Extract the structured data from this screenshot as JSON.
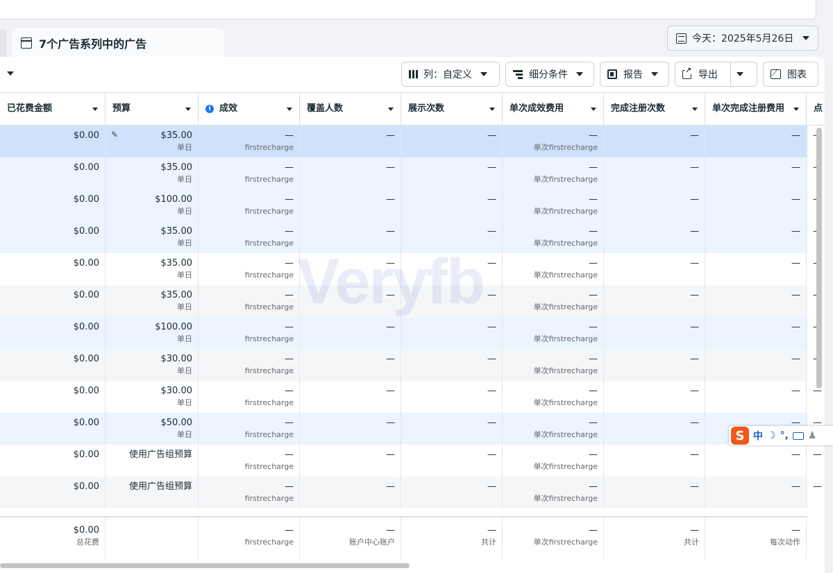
{
  "tab_title": "7个广告系列中的广告",
  "date_range_label": "今天：2025年5月26日",
  "toolbar": {
    "columns_label": "列：自定义",
    "breakdown_label": "细分条件",
    "reports_label": "报告",
    "export_label": "导出",
    "charts_label": "图表"
  },
  "columns": [
    "已花费金额",
    "预算",
    "成效",
    "覆盖人数",
    "展示次数",
    "单次成效费用",
    "完成注册次数",
    "单次完成注册费用",
    "点"
  ],
  "rows": [
    {
      "spend": "$0.00",
      "budget": "$35.00",
      "budget_type": "单日",
      "results": "—",
      "results_sub": "firstrecharge",
      "reach": "—",
      "impressions": "—",
      "cpr": "—",
      "cpr_sub": "单次firstrecharge",
      "regs": "—",
      "cost_reg": "—",
      "last": "—"
    },
    {
      "spend": "$0.00",
      "budget": "$35.00",
      "budget_type": "单日",
      "results": "—",
      "results_sub": "firstrecharge",
      "reach": "—",
      "impressions": "—",
      "cpr": "—",
      "cpr_sub": "单次firstrecharge",
      "regs": "—",
      "cost_reg": "—",
      "last": "—"
    },
    {
      "spend": "$0.00",
      "budget": "$100.00",
      "budget_type": "单日",
      "results": "—",
      "results_sub": "firstrecharge",
      "reach": "—",
      "impressions": "—",
      "cpr": "—",
      "cpr_sub": "单次firstrecharge",
      "regs": "—",
      "cost_reg": "—",
      "last": "—"
    },
    {
      "spend": "$0.00",
      "budget": "$35.00",
      "budget_type": "单日",
      "results": "—",
      "results_sub": "firstrecharge",
      "reach": "—",
      "impressions": "—",
      "cpr": "—",
      "cpr_sub": "单次firstrecharge",
      "regs": "—",
      "cost_reg": "—",
      "last": "—"
    },
    {
      "spend": "$0.00",
      "budget": "$35.00",
      "budget_type": "单日",
      "results": "—",
      "results_sub": "firstrecharge",
      "reach": "—",
      "impressions": "—",
      "cpr": "—",
      "cpr_sub": "单次firstrecharge",
      "regs": "—",
      "cost_reg": "—",
      "last": "—"
    },
    {
      "spend": "$0.00",
      "budget": "$35.00",
      "budget_type": "单日",
      "results": "—",
      "results_sub": "firstrecharge",
      "reach": "—",
      "impressions": "—",
      "cpr": "—",
      "cpr_sub": "单次firstrecharge",
      "regs": "—",
      "cost_reg": "—",
      "last": "—"
    },
    {
      "spend": "$0.00",
      "budget": "$100.00",
      "budget_type": "单日",
      "results": "—",
      "results_sub": "firstrecharge",
      "reach": "—",
      "impressions": "—",
      "cpr": "—",
      "cpr_sub": "单次firstrecharge",
      "regs": "—",
      "cost_reg": "—",
      "last": "—"
    },
    {
      "spend": "$0.00",
      "budget": "$30.00",
      "budget_type": "单日",
      "results": "—",
      "results_sub": "firstrecharge",
      "reach": "—",
      "impressions": "—",
      "cpr": "—",
      "cpr_sub": "单次firstrecharge",
      "regs": "—",
      "cost_reg": "—",
      "last": "—"
    },
    {
      "spend": "$0.00",
      "budget": "$30.00",
      "budget_type": "单日",
      "results": "—",
      "results_sub": "firstrecharge",
      "reach": "—",
      "impressions": "—",
      "cpr": "—",
      "cpr_sub": "单次firstrecharge",
      "regs": "—",
      "cost_reg": "—",
      "last": "—"
    },
    {
      "spend": "$0.00",
      "budget": "$50.00",
      "budget_type": "单日",
      "results": "—",
      "results_sub": "firstrecharge",
      "reach": "—",
      "impressions": "—",
      "cpr": "—",
      "cpr_sub": "单次firstrecharge",
      "regs": "—",
      "cost_reg": "—",
      "last": "—"
    },
    {
      "spend": "$0.00",
      "budget": "使用广告组预算",
      "budget_type": "",
      "results": "—",
      "results_sub": "firstrecharge",
      "reach": "—",
      "impressions": "—",
      "cpr": "—",
      "cpr_sub": "单次firstrecharge",
      "regs": "—",
      "cost_reg": "—",
      "last": "—"
    },
    {
      "spend": "$0.00",
      "budget": "使用广告组预算",
      "budget_type": "",
      "results": "—",
      "results_sub": "firstrecharge",
      "reach": "—",
      "impressions": "—",
      "cpr": "—",
      "cpr_sub": "单次firstrecharge",
      "regs": "—",
      "cost_reg": "—",
      "last": "—"
    }
  ],
  "row_styles": [
    "selected",
    "light",
    "light",
    "light",
    "white",
    "gray",
    "light",
    "gray",
    "white",
    "light",
    "white",
    "gray"
  ],
  "totals": {
    "spend": "$0.00",
    "spend_sub": "总花费",
    "results": "—",
    "results_sub": "firstrecharge",
    "reach": "—",
    "reach_sub": "账户中心账户",
    "impressions": "—",
    "impressions_sub": "共计",
    "cpr": "—",
    "cpr_sub": "单次firstrecharge",
    "regs": "—",
    "regs_sub": "共计",
    "cost_reg": "—",
    "cost_reg_sub": "每次动作"
  },
  "watermark": "Veryfb",
  "ime": {
    "logo": "S",
    "mode": "中",
    "moon": "☽",
    "punct": "°,"
  },
  "colors": {
    "selected": "#cfe2fb",
    "light": "#ebf4ff",
    "gray": "#f5f6f7",
    "white": "#ffffff",
    "accent": "#1877f2"
  }
}
